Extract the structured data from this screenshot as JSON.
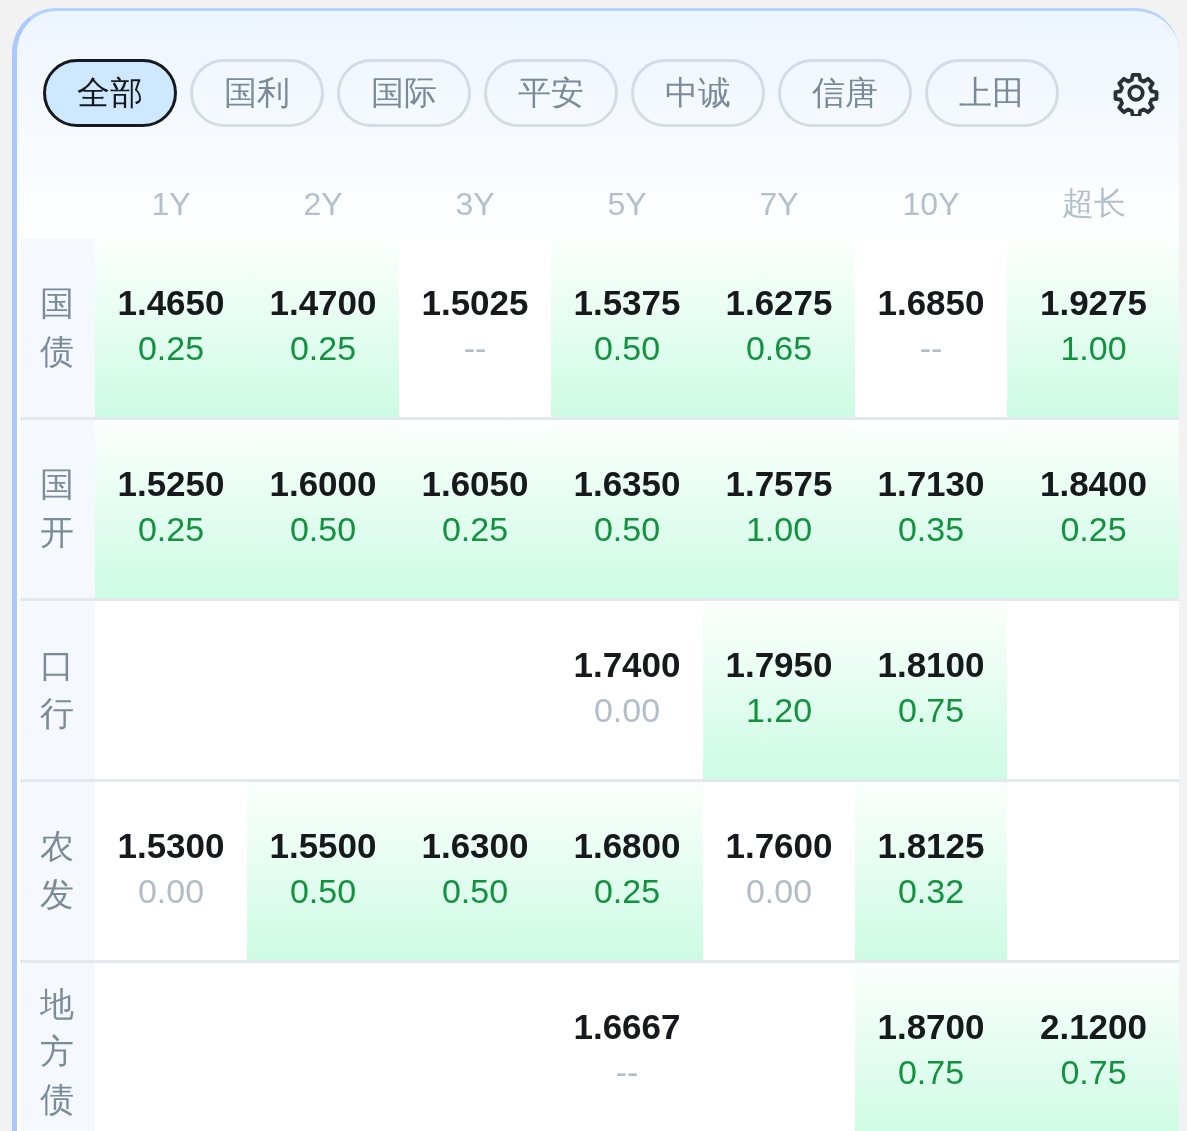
{
  "tabs": [
    {
      "label": "全部",
      "selected": true
    },
    {
      "label": "国利",
      "selected": false
    },
    {
      "label": "国际",
      "selected": false
    },
    {
      "label": "平安",
      "selected": false
    },
    {
      "label": "中诚",
      "selected": false
    },
    {
      "label": "信唐",
      "selected": false
    },
    {
      "label": "上田",
      "selected": false
    }
  ],
  "table": {
    "columns": [
      "1Y",
      "2Y",
      "3Y",
      "5Y",
      "7Y",
      "10Y",
      "超长"
    ],
    "rows": [
      {
        "label": "国债",
        "cells": [
          {
            "yield": "1.4650",
            "change": "0.25",
            "up": true
          },
          {
            "yield": "1.4700",
            "change": "0.25",
            "up": true
          },
          {
            "yield": "1.5025",
            "change": "--",
            "up": false
          },
          {
            "yield": "1.5375",
            "change": "0.50",
            "up": true
          },
          {
            "yield": "1.6275",
            "change": "0.65",
            "up": true
          },
          {
            "yield": "1.6850",
            "change": "--",
            "up": false
          },
          {
            "yield": "1.9275",
            "change": "1.00",
            "up": true
          }
        ]
      },
      {
        "label": "国开",
        "cells": [
          {
            "yield": "1.5250",
            "change": "0.25",
            "up": true
          },
          {
            "yield": "1.6000",
            "change": "0.50",
            "up": true
          },
          {
            "yield": "1.6050",
            "change": "0.25",
            "up": true
          },
          {
            "yield": "1.6350",
            "change": "0.50",
            "up": true
          },
          {
            "yield": "1.7575",
            "change": "1.00",
            "up": true
          },
          {
            "yield": "1.7130",
            "change": "0.35",
            "up": true
          },
          {
            "yield": "1.8400",
            "change": "0.25",
            "up": true
          }
        ]
      },
      {
        "label": "口行",
        "cells": [
          null,
          null,
          null,
          {
            "yield": "1.7400",
            "change": "0.00",
            "up": false
          },
          {
            "yield": "1.7950",
            "change": "1.20",
            "up": true
          },
          {
            "yield": "1.8100",
            "change": "0.75",
            "up": true
          },
          null
        ]
      },
      {
        "label": "农发",
        "cells": [
          {
            "yield": "1.5300",
            "change": "0.00",
            "up": false
          },
          {
            "yield": "1.5500",
            "change": "0.50",
            "up": true
          },
          {
            "yield": "1.6300",
            "change": "0.50",
            "up": true
          },
          {
            "yield": "1.6800",
            "change": "0.25",
            "up": true
          },
          {
            "yield": "1.7600",
            "change": "0.00",
            "up": false
          },
          {
            "yield": "1.8125",
            "change": "0.32",
            "up": true
          },
          null
        ]
      },
      {
        "label": "地方债",
        "cells": [
          null,
          null,
          null,
          {
            "yield": "1.6667",
            "change": "--",
            "up": false
          },
          null,
          {
            "yield": "1.8700",
            "change": "0.75",
            "up": true
          },
          {
            "yield": "2.1200",
            "change": "0.75",
            "up": true
          }
        ]
      }
    ]
  }
}
